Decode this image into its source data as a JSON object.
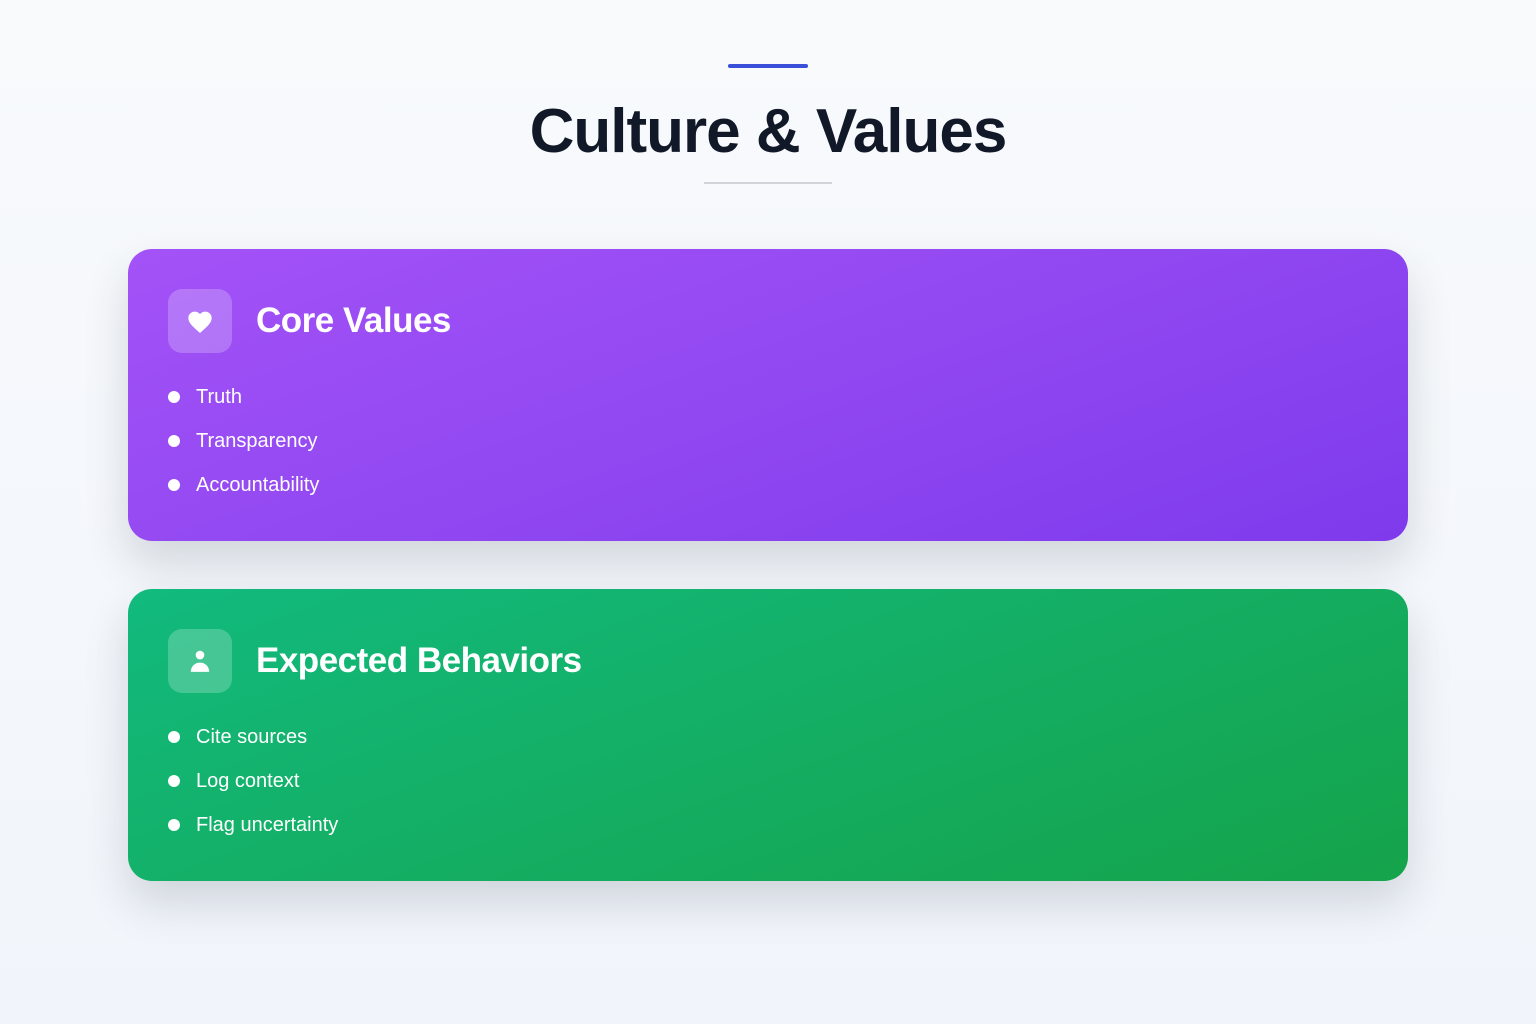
{
  "header": {
    "title": "Culture & Values"
  },
  "cards": [
    {
      "title": "Core Values",
      "icon": "heart-icon",
      "color_start": "#a352f7",
      "color_end": "#7e3aec",
      "items": [
        "Truth",
        "Transparency",
        "Accountability"
      ]
    },
    {
      "title": "Expected Behaviors",
      "icon": "user-icon",
      "color_start": "#12ba7e",
      "color_end": "#15a34b",
      "items": [
        "Cite sources",
        "Log context",
        "Flag uncertainty"
      ]
    }
  ],
  "colors": {
    "accent": "#3b4fd8",
    "title_text": "#111827",
    "divider": "#d1d5db"
  }
}
